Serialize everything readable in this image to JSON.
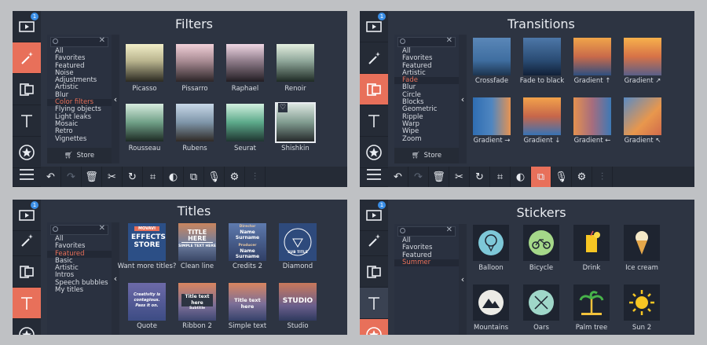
{
  "colors": {
    "accent": "#e8705a",
    "panel": "#2d3442",
    "sidebar": "#252b36",
    "badge": "#3a8ee6"
  },
  "badge": "1",
  "filters": {
    "title": "Filters",
    "search_placeholder": "",
    "categories": [
      "All",
      "Favorites",
      "Featured",
      "Noise",
      "Adjustments",
      "Artistic",
      "Blur",
      "Color filters",
      "Flying objects",
      "Light leaks",
      "Mosaic",
      "Retro",
      "Vignettes"
    ],
    "selected": "Color filters",
    "store": "Store",
    "tiles": [
      "Picasso",
      "Pissarro",
      "Raphael",
      "Renoir",
      "Rousseau",
      "Rubens",
      "Seurat",
      "Shishkin"
    ]
  },
  "transitions": {
    "title": "Transitions",
    "categories": [
      "All",
      "Favorites",
      "Featured",
      "Artistic",
      "Fade",
      "Blur",
      "Circle",
      "Blocks",
      "Geometric",
      "Ripple",
      "Warp",
      "Wipe",
      "Zoom"
    ],
    "selected": "Fade",
    "store": "Store",
    "tiles": [
      "Crossfade",
      "Fade to black",
      "Gradient ↑",
      "Gradient ↗",
      "Gradient →",
      "Gradient ↓",
      "Gradient ←",
      "Gradient ↖"
    ]
  },
  "titles": {
    "title": "Titles",
    "categories": [
      "All",
      "Favorites",
      "Featured",
      "Basic",
      "Artistic",
      "Intros",
      "Speech bubbles",
      "My titles"
    ],
    "selected": "Featured",
    "tiles": [
      "Want more titles?",
      "Clean line",
      "Credits 2",
      "Diamond",
      "Quote",
      "Ribbon 2",
      "Simple text",
      "Studio"
    ],
    "tile_text": {
      "effects_tag": "MOVAVI",
      "effects": "EFFECTS STORE",
      "clean": "TITLE HERE",
      "clean_sub": "SIMPLE TEXT HERE",
      "credits_director": "Director",
      "credits_name": "Name Surname",
      "credits_producer": "Producer",
      "credits_name2": "Name Surname",
      "diamond": "SUB TITLE",
      "quote": "Creativity is contagious. Pass it on.",
      "ribbon": "Title text here",
      "ribbon_sub": "Subtitle",
      "simple": "Title text here",
      "studio": "STUDIO"
    }
  },
  "stickers": {
    "title": "Stickers",
    "categories": [
      "All",
      "Favorites",
      "Featured",
      "Summer"
    ],
    "selected": "Summer",
    "tiles": [
      "Balloon",
      "Bicycle",
      "Drink",
      "Ice cream",
      "Mountains",
      "Oars",
      "Palm tree",
      "Sun 2"
    ]
  }
}
